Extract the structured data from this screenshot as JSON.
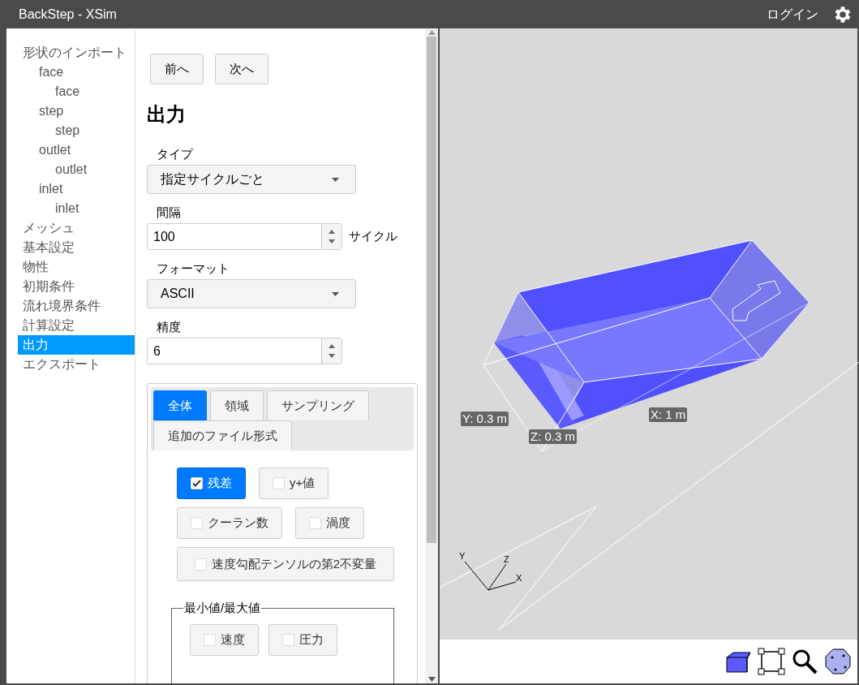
{
  "window": {
    "title": "BackStep - XSim"
  },
  "header": {
    "login": "ログイン"
  },
  "sidebar": {
    "items": [
      {
        "label": "形状のインポート",
        "selected": false,
        "children": [
          {
            "label": "face",
            "selected": false,
            "children": [
              {
                "label": "face",
                "selected": false
              }
            ]
          },
          {
            "label": "step",
            "selected": false,
            "children": [
              {
                "label": "step",
                "selected": false
              }
            ]
          },
          {
            "label": "outlet",
            "selected": false,
            "children": [
              {
                "label": "outlet",
                "selected": false
              }
            ]
          },
          {
            "label": "inlet",
            "selected": false,
            "children": [
              {
                "label": "inlet",
                "selected": false
              }
            ]
          }
        ]
      },
      {
        "label": "メッシュ",
        "selected": false
      },
      {
        "label": "基本設定",
        "selected": false
      },
      {
        "label": "物性",
        "selected": false
      },
      {
        "label": "初期条件",
        "selected": false
      },
      {
        "label": "流れ境界条件",
        "selected": false
      },
      {
        "label": "計算設定",
        "selected": false
      },
      {
        "label": "出力",
        "selected": true
      },
      {
        "label": "エクスポート",
        "selected": false
      }
    ]
  },
  "nav_buttons": [
    "前へ",
    "次へ"
  ],
  "section_title": "出力",
  "fields": [
    {
      "kind": "select",
      "label": "タイプ",
      "value": "指定サイクルごと"
    },
    {
      "kind": "number",
      "label": "間隔",
      "value": "100",
      "unit": "サイクル"
    },
    {
      "kind": "select",
      "label": "フォーマット",
      "value": "ASCII"
    },
    {
      "kind": "number",
      "label": "精度",
      "value": "6"
    }
  ],
  "tabs": [
    {
      "label": "全体",
      "selected": true
    },
    {
      "label": "領域",
      "selected": false
    },
    {
      "label": "サンプリング",
      "selected": false
    },
    {
      "label": "追加のファイル形式",
      "selected": false
    }
  ],
  "toggles": [
    {
      "label": "残差",
      "checked": true
    },
    {
      "label": "y+値",
      "checked": false
    },
    {
      "label": "クーラン数",
      "checked": false
    },
    {
      "label": "渦度",
      "checked": false
    },
    {
      "label": "速度勾配テンソルの第2不変量",
      "checked": false
    }
  ],
  "min_max": {
    "legend": "最小値/最大値",
    "toggles": [
      {
        "label": "速度",
        "checked": false
      },
      {
        "label": "圧力",
        "checked": false
      }
    ]
  },
  "viewport": {
    "dimension_labels": [
      "Y: 0.3 m",
      "Z: 0.3 m",
      "X: 1 m"
    ],
    "axis_labels": [
      "Y",
      "Z",
      "X"
    ]
  }
}
